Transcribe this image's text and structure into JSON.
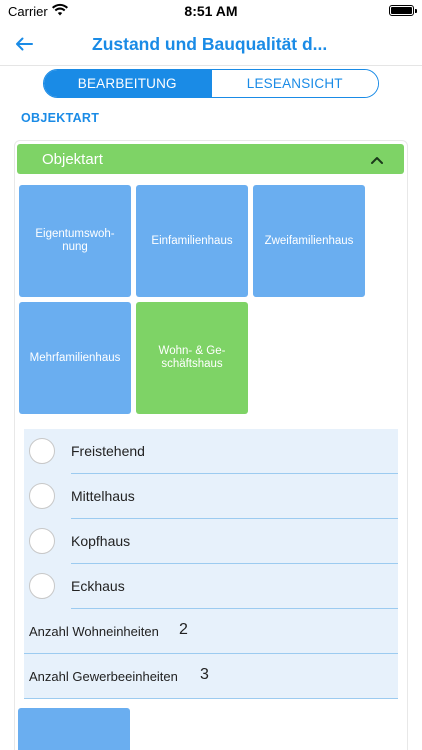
{
  "status_bar": {
    "carrier": "Carrier",
    "time": "8:51 AM",
    "wifi_icon": "wifi-icon",
    "battery_icon": "battery-icon"
  },
  "nav": {
    "back_icon": "arrow-left-icon",
    "title": "Zustand und Bauqualität d..."
  },
  "segments": {
    "edit": "BEARBEITUNG",
    "read": "LESEANSICHT",
    "active": "edit"
  },
  "section_label": "OBJEKTART",
  "accordion": {
    "title": "Objektart",
    "icon": "chevron-up-icon",
    "tiles": [
      {
        "label": "Eigentumswoh-\nnung",
        "selected": false
      },
      {
        "label": "Einfamilienhaus",
        "selected": false
      },
      {
        "label": "Zweifamilienhaus",
        "selected": false
      },
      {
        "label": "Mehrfamilienhaus",
        "selected": false
      },
      {
        "label": "Wohn- & Ge-\nschäftshaus",
        "selected": true
      }
    ],
    "options": [
      {
        "label": "Freistehend",
        "checked": false
      },
      {
        "label": "Mittelhaus",
        "checked": false
      },
      {
        "label": "Kopfhaus",
        "checked": false
      },
      {
        "label": "Eckhaus",
        "checked": false
      }
    ],
    "counts": [
      {
        "label": "Anzahl Wohneinheiten",
        "value": "2"
      },
      {
        "label": "Anzahl Gewerbeeinheiten",
        "value": "3"
      }
    ]
  },
  "colors": {
    "accent": "#1a8be6",
    "tile": "#6aaef0",
    "selected": "#7ed366",
    "option_bg": "#e7f1fb"
  }
}
